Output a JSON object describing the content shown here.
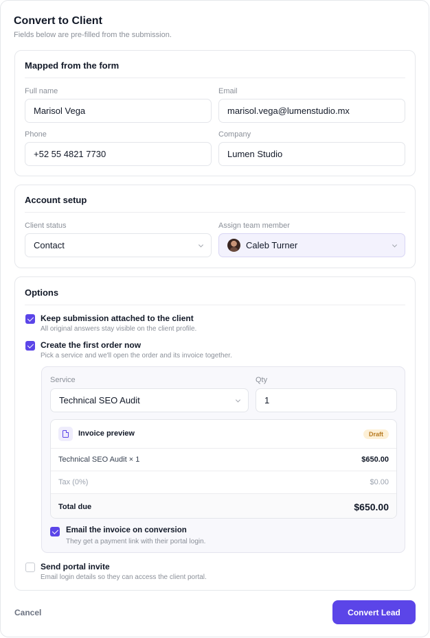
{
  "dialog": {
    "title": "Convert to Client",
    "subtitle": "Fields below are pre-filled from the submission."
  },
  "mapped": {
    "title": "Mapped from the form",
    "full_name_label": "Full name",
    "full_name_value": "Marisol Vega",
    "email_label": "Email",
    "email_value": "marisol.vega@lumenstudio.mx",
    "phone_label": "Phone",
    "phone_value": "+52 55 4821 7730",
    "company_label": "Company",
    "company_value": "Lumen Studio"
  },
  "account": {
    "title": "Account setup",
    "status_label": "Client status",
    "status_value": "Contact",
    "assign_label": "Assign team member",
    "assign_value": "Caleb Turner"
  },
  "options": {
    "title": "Options",
    "keep": {
      "label": "Keep submission attached to the client",
      "desc": "All original answers stay visible on the client profile.",
      "checked": true
    },
    "first_order": {
      "label": "Create the first order now",
      "desc": "Pick a service and we'll open the order and its invoice together.",
      "checked": true
    },
    "order": {
      "service_label": "Service",
      "service_value": "Technical SEO Audit",
      "qty_label": "Qty",
      "qty_value": "1",
      "invoice": {
        "title": "Invoice preview",
        "status": "Draft",
        "line_label": "Technical SEO Audit × 1",
        "line_amount": "$650.00",
        "tax_label": "Tax (0%)",
        "tax_amount": "$0.00",
        "total_label": "Total due",
        "total_amount": "$650.00"
      },
      "email_invoice": {
        "label": "Email the invoice on conversion",
        "desc": "They get a payment link with their portal login.",
        "checked": true
      }
    },
    "portal": {
      "label": "Send portal invite",
      "desc": "Email login details so they can access the client portal.",
      "checked": false
    }
  },
  "footer": {
    "cancel_label": "Cancel",
    "convert_label": "Convert Lead"
  },
  "colors": {
    "accent": "#5b45e8",
    "badge_bg": "#fdf0d6",
    "badge_text": "#b7791f"
  }
}
